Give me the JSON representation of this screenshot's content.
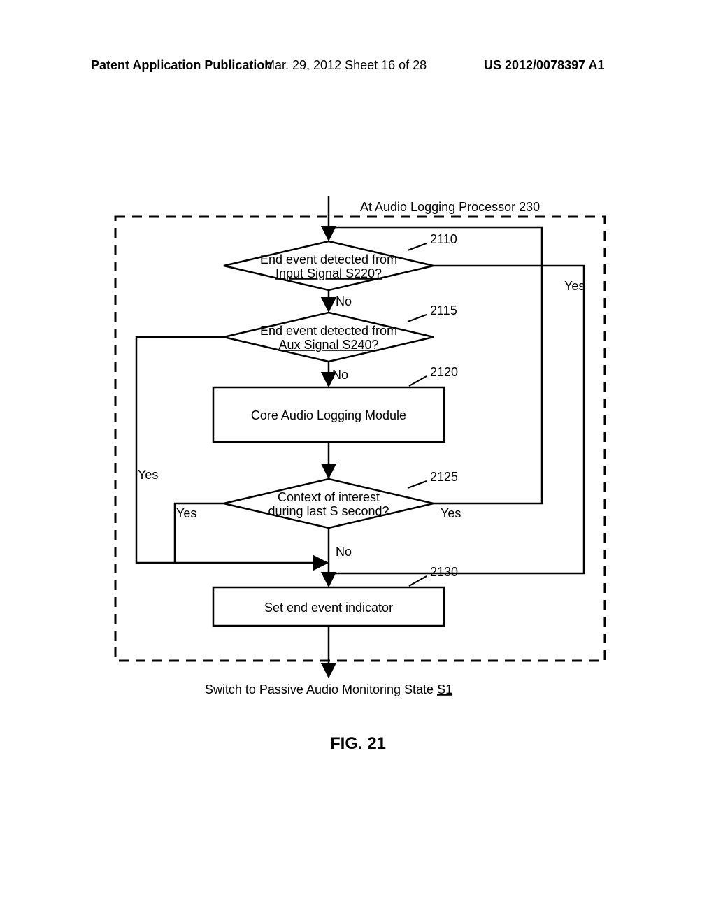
{
  "header": {
    "left": "Patent Application Publication",
    "mid": "Mar. 29, 2012  Sheet 16 of 28",
    "right": "US 2012/0078397 A1"
  },
  "chart_data": {
    "type": "flowchart",
    "title": "At Audio Logging Processor 230",
    "nodes": [
      {
        "id": "d2110",
        "ref": "2110",
        "kind": "decision",
        "line1": "End event detected from",
        "line2": "Input Signal S220?"
      },
      {
        "id": "d2115",
        "ref": "2115",
        "kind": "decision",
        "line1": "End event detected from",
        "line2": "Aux Signal S240?"
      },
      {
        "id": "p2120",
        "ref": "2120",
        "kind": "process",
        "text": "Core Audio Logging Module"
      },
      {
        "id": "d2125",
        "ref": "2125",
        "kind": "decision",
        "line1": "Context of interest",
        "line2": "during last S second?"
      },
      {
        "id": "p2130",
        "ref": "2130",
        "kind": "process",
        "text": "Set end event indicator"
      }
    ],
    "edges": [
      {
        "from": "entry",
        "to": "d2110",
        "label": ""
      },
      {
        "from": "d2110",
        "to": "d2115",
        "label": "No"
      },
      {
        "from": "d2110",
        "to": "p2130",
        "label": "Yes",
        "route": "right"
      },
      {
        "from": "d2115",
        "to": "p2120",
        "label": "No"
      },
      {
        "from": "d2115",
        "to": "p2130",
        "label": "Yes",
        "route": "left"
      },
      {
        "from": "p2120",
        "to": "d2125",
        "label": ""
      },
      {
        "from": "d2125",
        "to": "entry",
        "label": "Yes",
        "route": "right-loop"
      },
      {
        "from": "d2125",
        "to": "p2130",
        "label": "No"
      },
      {
        "from": "p2130",
        "to": "exit",
        "label": ""
      }
    ],
    "exit_pre": "Switch to Passive Audio Monitoring State ",
    "exit_ul": "S1"
  },
  "labels": {
    "yes": "Yes",
    "no": "No"
  },
  "figure": "FIG. 21"
}
